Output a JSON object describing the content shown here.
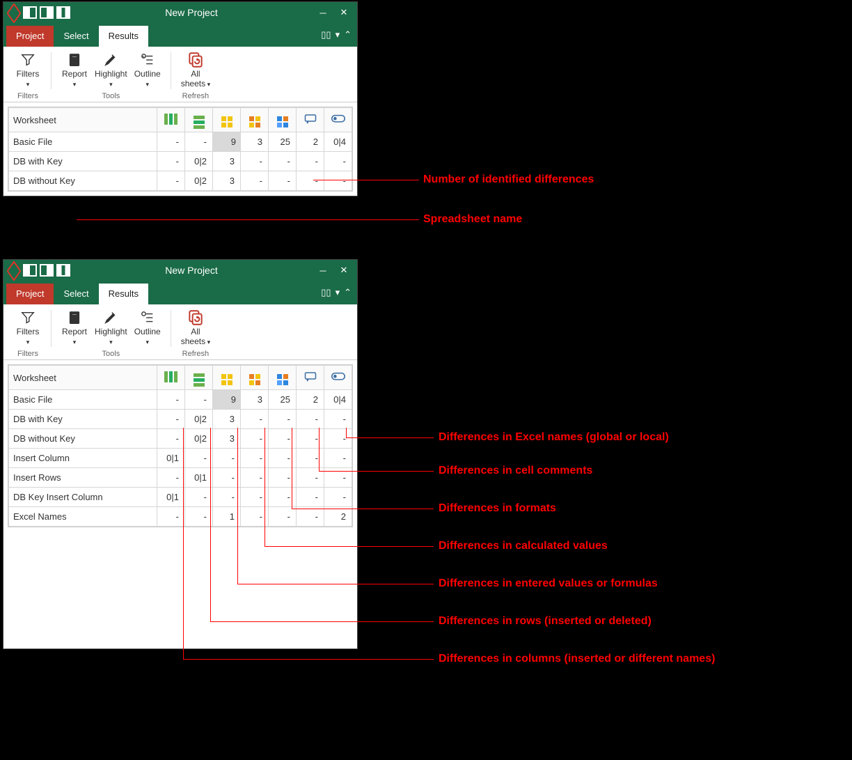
{
  "windows": [
    {
      "title": "New Project",
      "tabs": {
        "project": "Project",
        "select": "Select",
        "results": "Results"
      },
      "ribbon": {
        "filters": {
          "label": "Filters",
          "group": "Filters"
        },
        "report": "Report",
        "highlight": "Highlight",
        "outline": "Outline",
        "tools_group": "Tools",
        "allsheets": "All\nsheets",
        "refresh_group": "Refresh"
      },
      "grid_header": "Worksheet",
      "rows": [
        {
          "name": "Basic File",
          "cols": "-",
          "rows": "-",
          "ent": "9",
          "calc": "3",
          "fmt": "25",
          "cmt": "2",
          "nm": "0|4",
          "ent_hl": true
        },
        {
          "name": "DB with Key",
          "cols": "-",
          "rows": "0|2",
          "ent": "3",
          "calc": "-",
          "fmt": "-",
          "cmt": "-",
          "nm": "-"
        },
        {
          "name": "DB without Key",
          "cols": "-",
          "rows": "0|2",
          "ent": "3",
          "calc": "-",
          "fmt": "-",
          "cmt": "-",
          "nm": "-"
        }
      ]
    },
    {
      "title": "New Project",
      "tabs": {
        "project": "Project",
        "select": "Select",
        "results": "Results"
      },
      "ribbon": {
        "filters": {
          "label": "Filters",
          "group": "Filters"
        },
        "report": "Report",
        "highlight": "Highlight",
        "outline": "Outline",
        "tools_group": "Tools",
        "allsheets": "All\nsheets",
        "refresh_group": "Refresh"
      },
      "grid_header": "Worksheet",
      "rows": [
        {
          "name": "Basic File",
          "cols": "-",
          "rows": "-",
          "ent": "9",
          "calc": "3",
          "fmt": "25",
          "cmt": "2",
          "nm": "0|4",
          "ent_hl": true
        },
        {
          "name": "DB with Key",
          "cols": "-",
          "rows": "0|2",
          "ent": "3",
          "calc": "-",
          "fmt": "-",
          "cmt": "-",
          "nm": "-"
        },
        {
          "name": "DB without Key",
          "cols": "-",
          "rows": "0|2",
          "ent": "3",
          "calc": "-",
          "fmt": "-",
          "cmt": "-",
          "nm": "-"
        },
        {
          "name": "Insert Column",
          "cols": "0|1",
          "rows": "-",
          "ent": "-",
          "calc": "-",
          "fmt": "-",
          "cmt": "-",
          "nm": "-"
        },
        {
          "name": "Insert Rows",
          "cols": "-",
          "rows": "0|1",
          "ent": "-",
          "calc": "-",
          "fmt": "-",
          "cmt": "-",
          "nm": "-"
        },
        {
          "name": "DB Key Insert Column",
          "cols": "0|1",
          "rows": "-",
          "ent": "-",
          "calc": "-",
          "fmt": "-",
          "cmt": "-",
          "nm": "-"
        },
        {
          "name": "Excel Names",
          "cols": "-",
          "rows": "-",
          "ent": "1",
          "calc": "-",
          "fmt": "-",
          "cmt": "-",
          "nm": "2"
        }
      ]
    }
  ],
  "annotations_top": [
    "Number of identified differences",
    "Spreadsheet name"
  ],
  "annotations_bottom": [
    "Differences in Excel names (global or local)",
    "Differences in cell comments",
    "Differences in formats",
    "Differences in calculated values",
    "Differences in entered values or formulas",
    "Differences in rows (inserted or deleted)",
    "Differences in columns (inserted or different names)"
  ]
}
